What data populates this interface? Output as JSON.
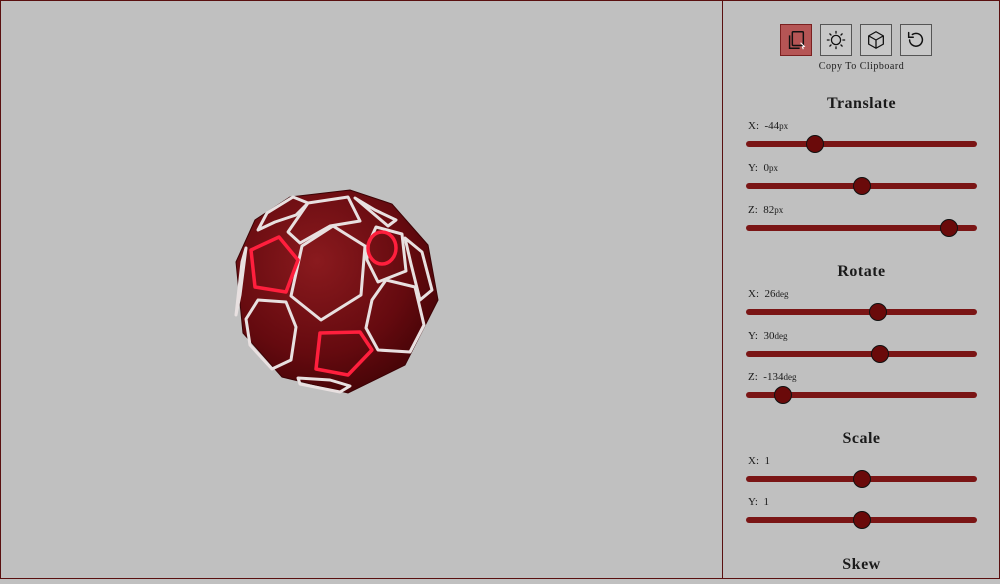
{
  "toolbar": {
    "copy_hint": "Copy To Clipboard",
    "buttons": [
      {
        "icon": "copy-icon",
        "active": true
      },
      {
        "icon": "sun-icon",
        "active": false
      },
      {
        "icon": "cube-icon",
        "active": false
      },
      {
        "icon": "reset-icon",
        "active": false
      }
    ]
  },
  "translate": {
    "title": "Translate",
    "x": {
      "label": "X:",
      "value": "-44",
      "unit": "px",
      "fraction": 0.3
    },
    "y": {
      "label": "Y:",
      "value": "0",
      "unit": "px",
      "fraction": 0.5
    },
    "z": {
      "label": "Z:",
      "value": "82",
      "unit": "px",
      "fraction": 0.88
    }
  },
  "rotate": {
    "title": "Rotate",
    "x": {
      "label": "X:",
      "value": "26",
      "unit": "deg",
      "fraction": 0.57
    },
    "y": {
      "label": "Y:",
      "value": "30",
      "unit": "deg",
      "fraction": 0.58
    },
    "z": {
      "label": "Z:",
      "value": "-134",
      "unit": "deg",
      "fraction": 0.16
    }
  },
  "scale": {
    "title": "Scale",
    "x": {
      "label": "X:",
      "value": "1",
      "fraction": 0.5
    },
    "y": {
      "label": "Y:",
      "value": "1",
      "fraction": 0.5
    }
  },
  "skew": {
    "title": "Skew"
  },
  "colors": {
    "accent": "#7a1515",
    "thumb": "#6a0a0a",
    "ball": "#6b0a10",
    "highlight": "#ff2244"
  }
}
